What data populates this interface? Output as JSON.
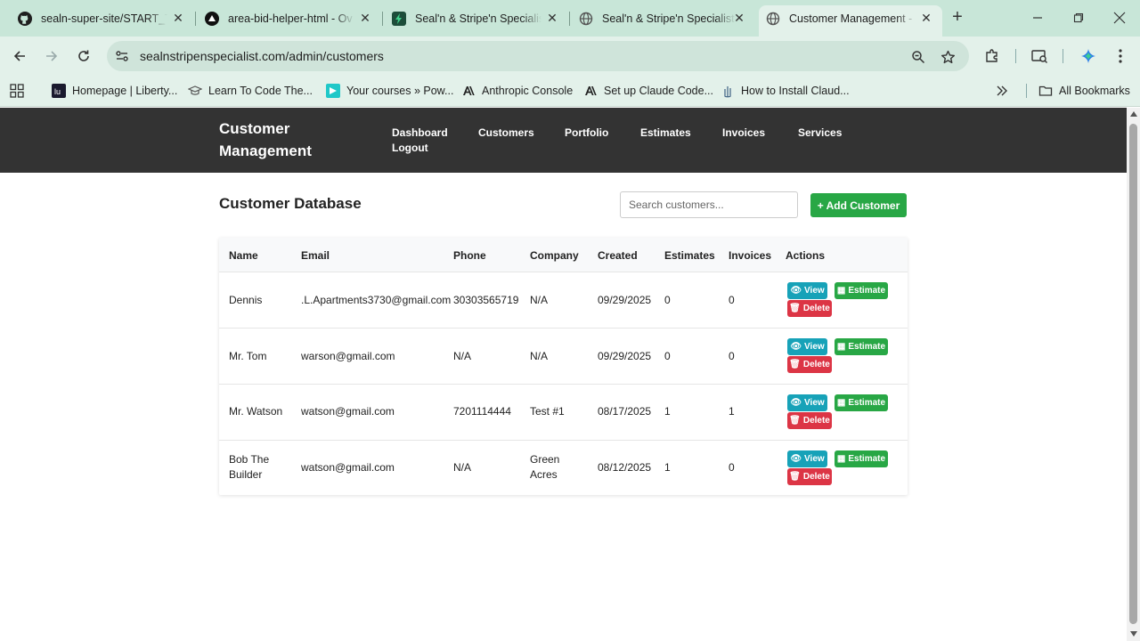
{
  "browser": {
    "tabs": [
      {
        "title": "sealn-super-site/START_TO",
        "icon": "github-icon"
      },
      {
        "title": "area-bid-helper-html - Ov",
        "icon": "vercel-icon"
      },
      {
        "title": "Seal'n & Stripe'n Specialist",
        "icon": "site-icon"
      },
      {
        "title": "Seal'n & Stripe'n Specialist",
        "icon": "globe-icon"
      },
      {
        "title": "Customer Management -",
        "icon": "globe-icon"
      }
    ],
    "url": "sealnstripenspecialist.com/admin/customers",
    "bookmarks": [
      "Homepage | Liberty...",
      "Learn To Code The...",
      "Your courses » Pow...",
      "Anthropic Console",
      "Set up Claude Code...",
      "How to Install Claud..."
    ],
    "all_bookmarks": "All Bookmarks"
  },
  "site": {
    "brand": "Customer Management",
    "nav": [
      "Dashboard",
      "Customers",
      "Portfolio",
      "Estimates",
      "Invoices",
      "Services",
      "Logout"
    ]
  },
  "main": {
    "title": "Customer Database",
    "search_placeholder": "Search customers...",
    "add_button": "+ Add Customer"
  },
  "table": {
    "columns": [
      "Name",
      "Email",
      "Phone",
      "Company",
      "Created",
      "Estimates",
      "Invoices",
      "Actions"
    ],
    "rows": [
      {
        "name": "Dennis",
        "email": ".L.Apartments3730@gmail.com",
        "phone": "30303565719",
        "company": "N/A",
        "created": "09/29/2025",
        "estimates": "0",
        "invoices": "0"
      },
      {
        "name": "Mr. Tom",
        "email": "warson@gmail.com",
        "phone": "N/A",
        "company": "N/A",
        "created": "09/29/2025",
        "estimates": "0",
        "invoices": "0"
      },
      {
        "name": "Mr. Watson",
        "email": "watson@gmail.com",
        "phone": "7201114444",
        "company": "Test #1",
        "created": "08/17/2025",
        "estimates": "1",
        "invoices": "1"
      },
      {
        "name": "Bob The Builder",
        "email": "watson@gmail.com",
        "phone": "N/A",
        "company": "Green Acres",
        "created": "08/12/2025",
        "estimates": "1",
        "invoices": "0"
      }
    ],
    "actions": {
      "view": "View",
      "estimate": "Estimate",
      "delete": "Delete"
    }
  },
  "colors": {
    "header_bg": "#333333",
    "view": "#17a2b8",
    "estimate": "#28a745",
    "delete": "#dc3545"
  }
}
